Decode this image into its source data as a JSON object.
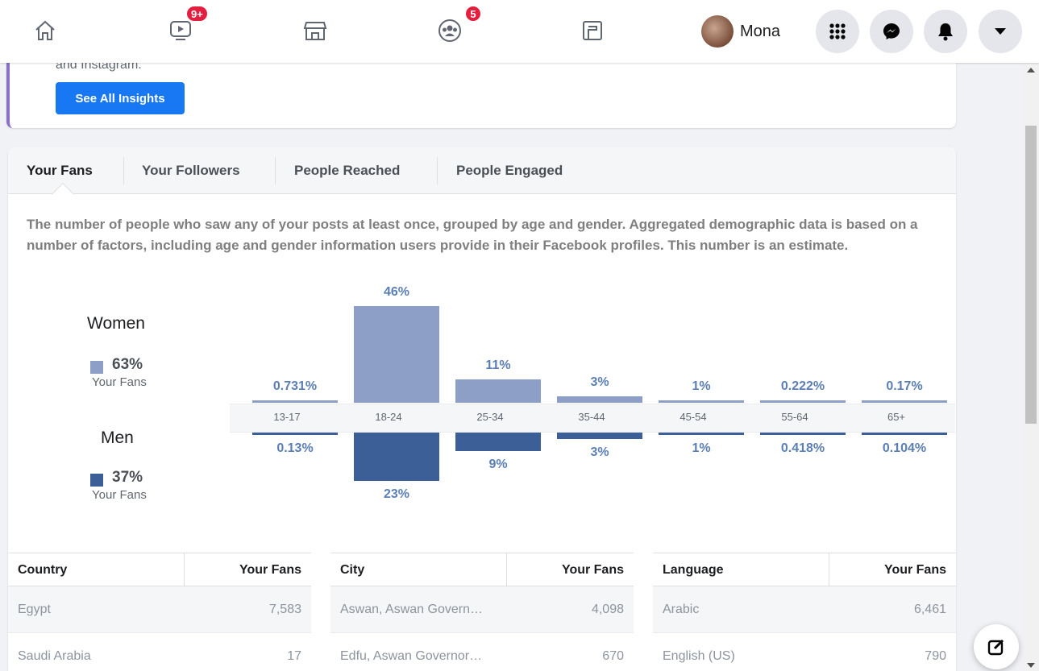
{
  "nav": {
    "watch_badge": "9+",
    "groups_badge": "5",
    "profile_name": "Mona",
    "icons": [
      "home-icon",
      "watch-icon",
      "marketplace-icon",
      "groups-icon",
      "gaming-icon",
      "menu-grid-icon",
      "messenger-icon",
      "notifications-icon",
      "account-dropdown-icon"
    ]
  },
  "insights_card": {
    "text": "and Instagram.",
    "button_label": "See All Insights"
  },
  "tabs": [
    {
      "label": "Your Fans"
    },
    {
      "label": "Your Followers"
    },
    {
      "label": "People Reached"
    },
    {
      "label": "People Engaged"
    }
  ],
  "description": "The number of people who saw any of your posts at least once, grouped by age and gender. Aggregated demographic data is based on a number of factors, including age and gender information users provide in their Facebook profiles. This number is an estimate.",
  "legend": {
    "women": {
      "title": "Women",
      "percent": "63%",
      "sub": "Your Fans",
      "color": "#8d9fc6"
    },
    "men": {
      "title": "Men",
      "percent": "37%",
      "sub": "Your Fans",
      "color": "#3b5f96"
    }
  },
  "chart_data": {
    "type": "bar",
    "categories": [
      "13-17",
      "18-24",
      "25-34",
      "35-44",
      "45-54",
      "55-64",
      "65+"
    ],
    "series": [
      {
        "name": "Women",
        "values": [
          0.731,
          46,
          11,
          3,
          1,
          0.222,
          0.17
        ],
        "labels": [
          "0.731%",
          "46%",
          "11%",
          "3%",
          "1%",
          "0.222%",
          "0.17%"
        ]
      },
      {
        "name": "Men",
        "values": [
          0.13,
          23,
          9,
          3,
          1,
          0.418,
          0.104
        ],
        "labels": [
          "0.13%",
          "23%",
          "9%",
          "3%",
          "1%",
          "0.418%",
          "0.104%"
        ]
      }
    ]
  },
  "tables": {
    "country": {
      "header_left": "Country",
      "header_right": "Your Fans",
      "rows": [
        {
          "name": "Egypt",
          "value": "7,583"
        },
        {
          "name": "Saudi Arabia",
          "value": "17"
        }
      ]
    },
    "city": {
      "header_left": "City",
      "header_right": "Your Fans",
      "rows": [
        {
          "name": "Aswan, Aswan Govern…",
          "value": "4,098"
        },
        {
          "name": "Edfu, Aswan Governor…",
          "value": "670"
        }
      ]
    },
    "language": {
      "header_left": "Language",
      "header_right": "Your Fans",
      "rows": [
        {
          "name": "Arabic",
          "value": "6,461"
        },
        {
          "name": "English (US)",
          "value": "790"
        }
      ]
    }
  }
}
